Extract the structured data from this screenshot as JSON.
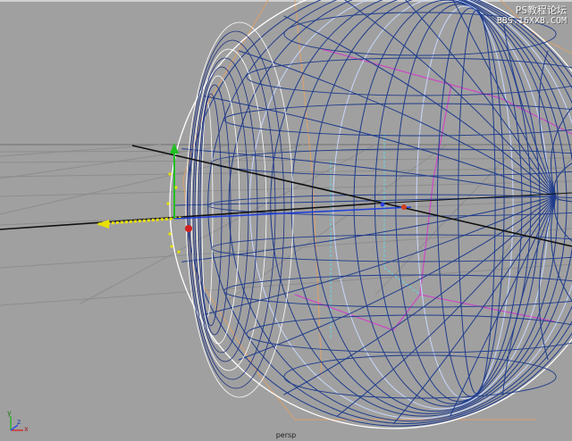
{
  "viewport": {
    "camera": "persp",
    "watermark_line1": "PS教程论坛",
    "watermark_line2": "BBS.16XX8.COM"
  },
  "axis_indicator": {
    "x": "x",
    "y": "y",
    "z": "z"
  },
  "colors": {
    "background": "#a0a0a0",
    "grid": "#8a8a8a",
    "wireframe": "#1f3c8c",
    "wireframe_light": "#ffffff",
    "guide_orange": "#e8a060",
    "guide_magenta": "#d040c8",
    "guide_cyan": "#5fd8e8",
    "axis_line": "#111111"
  },
  "icons": [
    "move-manipulator-icon",
    "pivot-point-icon",
    "axis-gizmo-icon"
  ]
}
